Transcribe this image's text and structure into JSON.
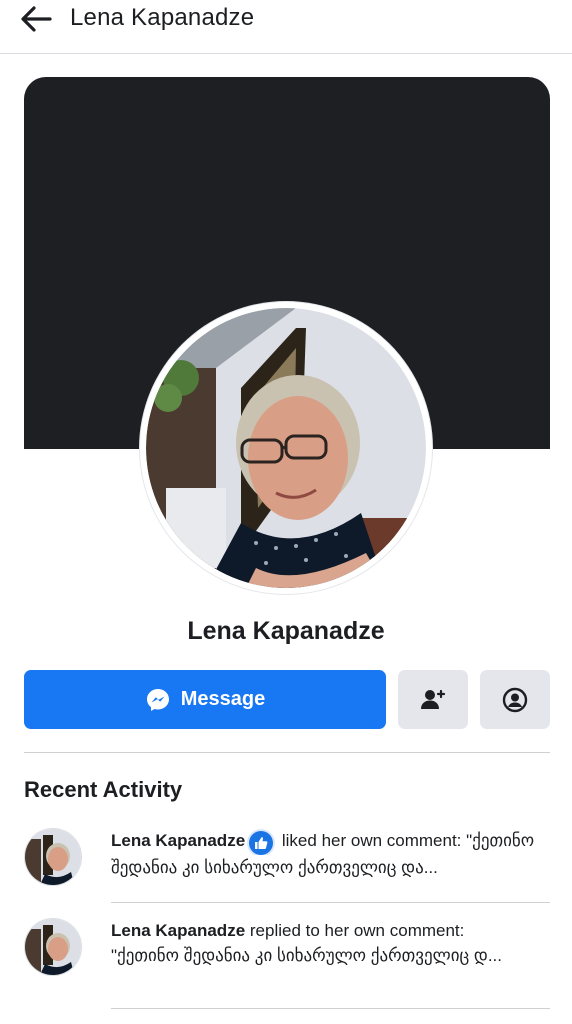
{
  "header": {
    "back_icon": "arrow-left-icon",
    "title": "Lena Kapanadze"
  },
  "profile": {
    "cover_color": "#1d1f23",
    "name": "Lena Kapanadze"
  },
  "actions": {
    "message_label": "Message",
    "message_icon": "messenger-icon",
    "add_friend_icon": "add-friend-icon",
    "profile_icon": "user-circle-icon",
    "accent": "#1877f2"
  },
  "recent_activity": {
    "title": "Recent Activity",
    "items": [
      {
        "actor": "Lena Kapanadze",
        "badge_icon": "like-thumb-icon",
        "line1_rest": " liked her own comment: \"ქეთინო",
        "line2": "შედანია კი სიხარულო ქართველიც და..."
      },
      {
        "actor": "Lena Kapanadze",
        "line1_rest": " replied to her own comment:",
        "line2": "\"ქეთინო შედანია კი სიხარულო ქართველიც დ..."
      }
    ]
  }
}
